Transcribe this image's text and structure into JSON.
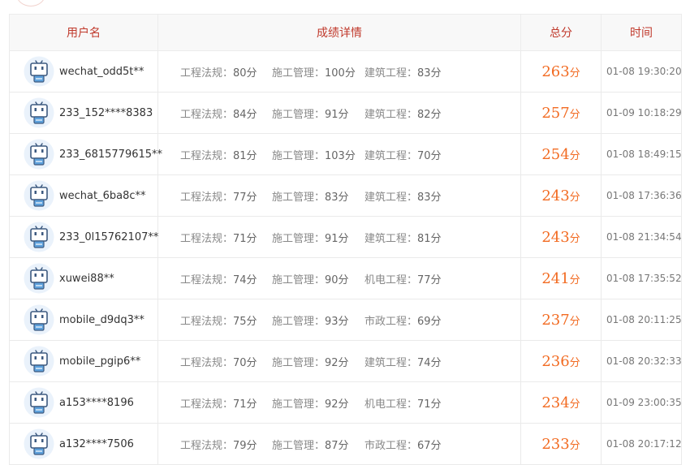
{
  "header": {
    "user": "用户名",
    "detail": "成绩详情",
    "total": "总分",
    "time": "时间"
  },
  "score_unit": "分",
  "colors": {
    "header_text": "#c0392b",
    "total_score": "#f26b22"
  },
  "avatar_icon": "robot-avatar-icon",
  "rows": [
    {
      "username": "wechat_odd5t**",
      "subjects": [
        {
          "name": "工程法规：",
          "score": "80分"
        },
        {
          "name": "施工管理：",
          "score": "100分"
        },
        {
          "name": "建筑工程：",
          "score": "83分"
        }
      ],
      "total": "263",
      "time": "01-08 19:30:20"
    },
    {
      "username": "233_152****8383",
      "subjects": [
        {
          "name": "工程法规：",
          "score": "84分"
        },
        {
          "name": "施工管理：",
          "score": "91分"
        },
        {
          "name": "建筑工程：",
          "score": "82分"
        }
      ],
      "total": "257",
      "time": "01-09 10:18:29"
    },
    {
      "username": "233_6815779615**",
      "subjects": [
        {
          "name": "工程法规：",
          "score": "81分"
        },
        {
          "name": "施工管理：",
          "score": "103分"
        },
        {
          "name": "建筑工程：",
          "score": "70分"
        }
      ],
      "total": "254",
      "time": "01-08 18:49:15"
    },
    {
      "username": "wechat_6ba8c**",
      "subjects": [
        {
          "name": "工程法规：",
          "score": "77分"
        },
        {
          "name": "施工管理：",
          "score": "83分"
        },
        {
          "name": "建筑工程：",
          "score": "83分"
        }
      ],
      "total": "243",
      "time": "01-08 17:36:36"
    },
    {
      "username": "233_0l15762107**",
      "subjects": [
        {
          "name": "工程法规：",
          "score": "71分"
        },
        {
          "name": "施工管理：",
          "score": "91分"
        },
        {
          "name": "建筑工程：",
          "score": "81分"
        }
      ],
      "total": "243",
      "time": "01-08 21:34:54"
    },
    {
      "username": "xuwei88**",
      "subjects": [
        {
          "name": "工程法规：",
          "score": "74分"
        },
        {
          "name": "施工管理：",
          "score": "90分"
        },
        {
          "name": "机电工程：",
          "score": "77分"
        }
      ],
      "total": "241",
      "time": "01-08 17:35:52"
    },
    {
      "username": "mobile_d9dq3**",
      "subjects": [
        {
          "name": "工程法规：",
          "score": "75分"
        },
        {
          "name": "施工管理：",
          "score": "93分"
        },
        {
          "name": "市政工程：",
          "score": "69分"
        }
      ],
      "total": "237",
      "time": "01-08 20:11:25"
    },
    {
      "username": "mobile_pgip6**",
      "subjects": [
        {
          "name": "工程法规：",
          "score": "70分"
        },
        {
          "name": "施工管理：",
          "score": "92分"
        },
        {
          "name": "建筑工程：",
          "score": "74分"
        }
      ],
      "total": "236",
      "time": "01-08 20:32:33"
    },
    {
      "username": "a153****8196",
      "subjects": [
        {
          "name": "工程法规：",
          "score": "71分"
        },
        {
          "name": "施工管理：",
          "score": "92分"
        },
        {
          "name": "机电工程：",
          "score": "71分"
        }
      ],
      "total": "234",
      "time": "01-09 23:00:35"
    },
    {
      "username": "a132****7506",
      "subjects": [
        {
          "name": "工程法规：",
          "score": "79分"
        },
        {
          "name": "施工管理：",
          "score": "87分"
        },
        {
          "name": "市政工程：",
          "score": "67分"
        }
      ],
      "total": "233",
      "time": "01-08 20:17:12"
    }
  ]
}
